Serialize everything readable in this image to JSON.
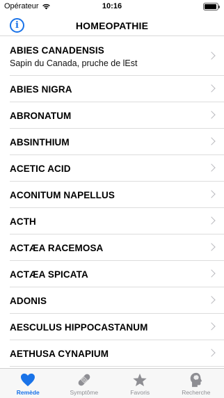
{
  "status": {
    "carrier": "Opérateur",
    "time": "10:16",
    "battery_level": 0.95
  },
  "nav": {
    "title": "HOMEOPATHIE",
    "info_icon": "info-icon",
    "info_glyph": "i"
  },
  "items": [
    {
      "title": "ABIES CANADENSIS",
      "subtitle": "Sapin du Canada, pruche de lEst"
    },
    {
      "title": "ABIES NIGRA"
    },
    {
      "title": "ABRONATUM"
    },
    {
      "title": "ABSINTHIUM"
    },
    {
      "title": "ACETIC ACID"
    },
    {
      "title": "ACONITUM NAPELLUS"
    },
    {
      "title": "ACTH"
    },
    {
      "title": "ACTÆA RACEMOSA"
    },
    {
      "title": "ACTÆA SPICATA"
    },
    {
      "title": "ADONIS"
    },
    {
      "title": "AESCULUS HIPPOCASTANUM"
    },
    {
      "title": "AETHUSA CYNAPIUM"
    }
  ],
  "tabs": [
    {
      "label": "Remède",
      "icon": "heart-icon",
      "active": true
    },
    {
      "label": "Symptôme",
      "icon": "bandage-icon",
      "active": false
    },
    {
      "label": "Favoris",
      "icon": "star-icon",
      "active": false
    },
    {
      "label": "Recherche",
      "icon": "brain-head-icon",
      "active": false
    }
  ],
  "colors": {
    "accent": "#1a73e8",
    "inactive": "#8e8e93",
    "separator": "#dcdcdc"
  }
}
